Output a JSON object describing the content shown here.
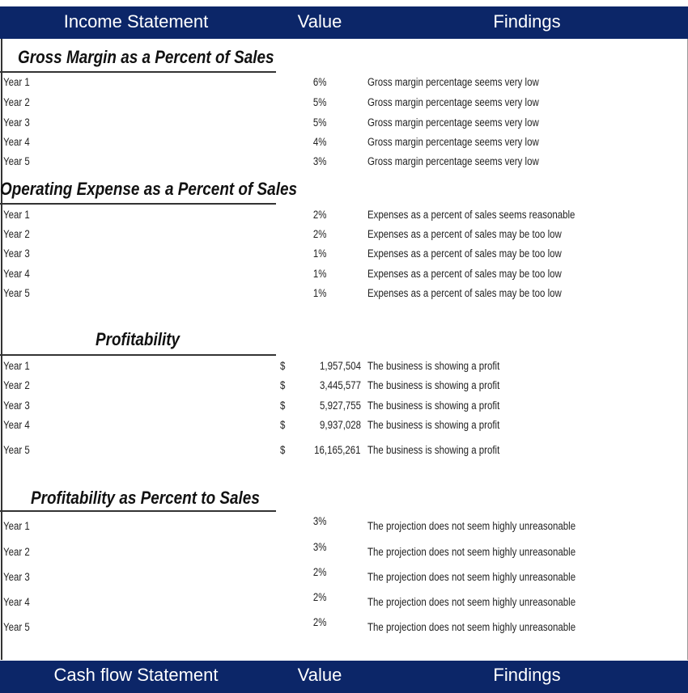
{
  "header_top": {
    "col1": "Income Statement",
    "col2": "Value",
    "col3": "Findings"
  },
  "sections": [
    {
      "title": "Gross Margin as a Percent of Sales",
      "type": "pct",
      "rows": [
        {
          "label": "Year 1",
          "value": "6%",
          "finding": "Gross margin percentage seems very low"
        },
        {
          "label": "Year 2",
          "value": "5%",
          "finding": "Gross margin percentage seems very low"
        },
        {
          "label": "Year 3",
          "value": "5%",
          "finding": "Gross margin percentage seems very low"
        },
        {
          "label": "Year 4",
          "value": "4%",
          "finding": "Gross margin percentage seems very low"
        },
        {
          "label": "Year 5",
          "value": "3%",
          "finding": "Gross margin percentage seems very low"
        }
      ]
    },
    {
      "title": "Operating Expense as a Percent of Sales",
      "type": "pct",
      "rows": [
        {
          "label": "Year 1",
          "value": "2%",
          "finding": "Expenses as a percent of sales seems reasonable"
        },
        {
          "label": "Year 2",
          "value": "2%",
          "finding": "Expenses as a percent of sales may be too low"
        },
        {
          "label": "Year 3",
          "value": "1%",
          "finding": "Expenses as a percent of sales may be too low"
        },
        {
          "label": "Year 4",
          "value": "1%",
          "finding": "Expenses as a percent of sales may be too low"
        },
        {
          "label": "Year 5",
          "value": "1%",
          "finding": "Expenses as a percent of sales may be too low"
        }
      ]
    },
    {
      "title": "Profitability",
      "type": "currency",
      "rows": [
        {
          "label": "Year 1",
          "currency": "$",
          "value": "1,957,504",
          "finding": "The business is showing a profit"
        },
        {
          "label": "Year 2",
          "currency": "$",
          "value": "3,445,577",
          "finding": "The business is showing a profit"
        },
        {
          "label": "Year 3",
          "currency": "$",
          "value": "5,927,755",
          "finding": "The business is showing a profit"
        },
        {
          "label": "Year 4",
          "currency": "$",
          "value": "9,937,028",
          "finding": "The business is showing a profit"
        },
        {
          "label": "Year 5",
          "currency": "$",
          "value": "16,165,261",
          "finding": "The business is showing a profit"
        }
      ]
    },
    {
      "title": "Profitability as Percent to Sales",
      "type": "pct",
      "rows": [
        {
          "label": "Year 1",
          "value": "3%",
          "finding": "The projection does not seem highly unreasonable"
        },
        {
          "label": "Year 2",
          "value": "3%",
          "finding": "The projection does not seem highly unreasonable"
        },
        {
          "label": "Year 3",
          "value": "2%",
          "finding": "The projection does not seem highly unreasonable"
        },
        {
          "label": "Year 4",
          "value": "2%",
          "finding": "The projection does not seem highly unreasonable"
        },
        {
          "label": "Year 5",
          "value": "2%",
          "finding": "The projection does not seem highly unreasonable"
        }
      ]
    }
  ],
  "header_bottom": {
    "col1": "Cash flow Statement",
    "col2": "Value",
    "col3": "Findings"
  },
  "colors": {
    "header_bg": "#0c2668",
    "header_text": "#ffffff"
  }
}
